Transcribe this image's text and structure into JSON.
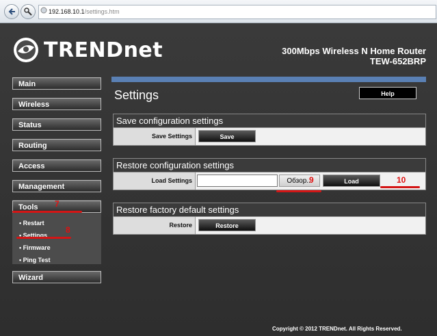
{
  "browser": {
    "url_host": "192.168.10.1",
    "url_path": "/settings.htm",
    "back_icon": "arrow-left-icon",
    "tools_icon": "wrench-icon",
    "site_icon": "globe-icon"
  },
  "header": {
    "logo_text": "TRENDnet",
    "title_line1": "300Mbps Wireless N Home Router",
    "title_line2": "TEW-652BRP"
  },
  "sidebar": {
    "items": [
      "Main",
      "Wireless",
      "Status",
      "Routing",
      "Access",
      "Management",
      "Tools",
      "Wizard"
    ],
    "tools_sub": [
      "Restart",
      "Settings",
      "Firmware",
      "Ping Test"
    ]
  },
  "main": {
    "title": "Settings",
    "help_label": "Help",
    "save": {
      "heading": "Save configuration settings",
      "label": "Save Settings",
      "button": "Save"
    },
    "restore_config": {
      "heading": "Restore configuration settings",
      "label": "Load Settings",
      "browse": "Обзор...",
      "load": "Load"
    },
    "factory": {
      "heading": "Restore factory default settings",
      "label": "Restore",
      "button": "Restore"
    }
  },
  "annotations": {
    "n7": "7",
    "n8": "8",
    "n9": "9",
    "n10": "10",
    "color": "#e01010"
  },
  "footer": {
    "copyright": "Copyright © 2012 TRENDnet. All Rights Reserved."
  },
  "colors": {
    "accent_bar": "#5a80b4",
    "background": "#3a3a3a"
  }
}
